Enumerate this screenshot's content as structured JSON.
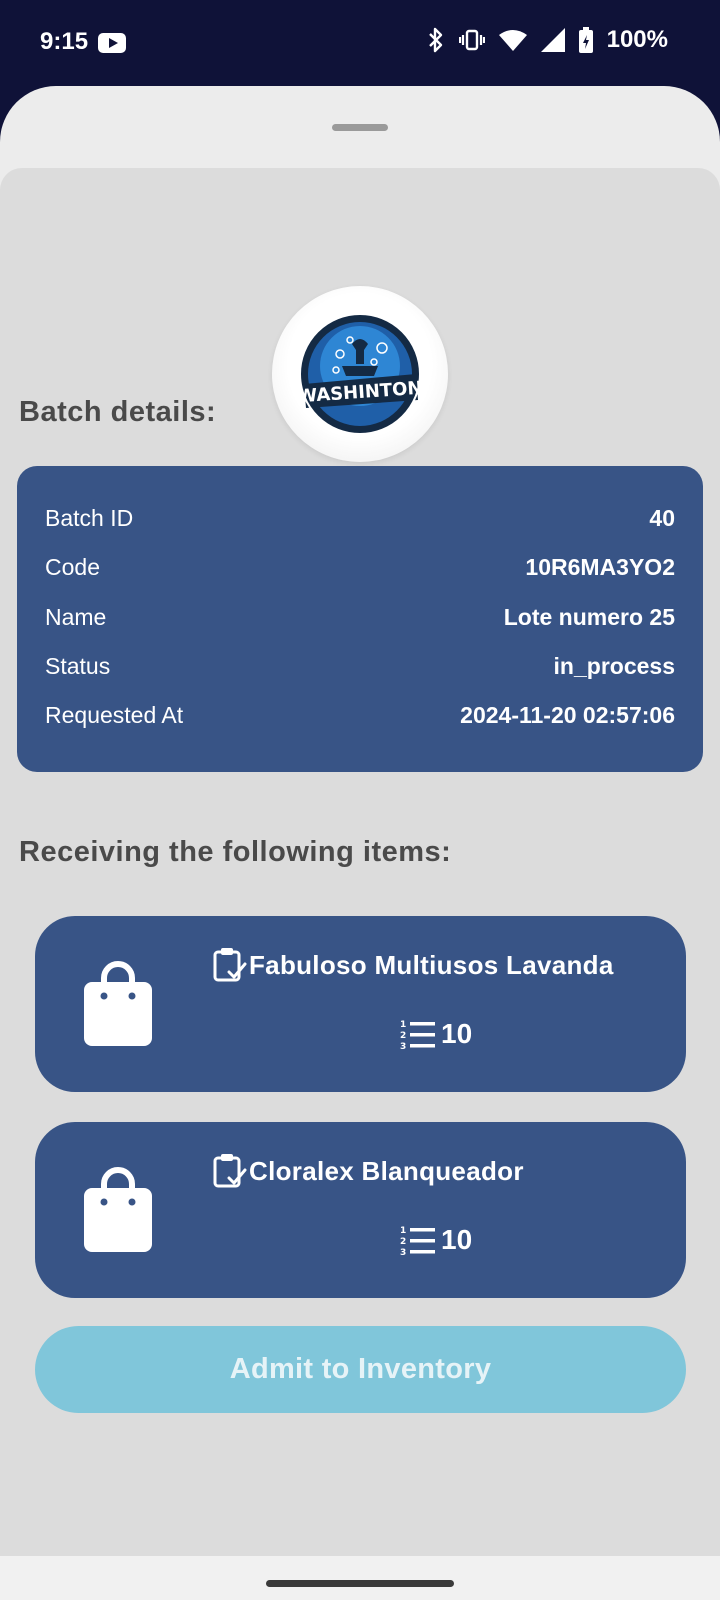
{
  "status_bar": {
    "time": "9:15",
    "battery_text": "100%",
    "icons": [
      "youtube-icon",
      "bluetooth-icon",
      "vibrate-icon",
      "wifi-icon",
      "signal-icon",
      "battery-charging-icon"
    ]
  },
  "logo": {
    "text": "WASHINTON"
  },
  "batch_section": {
    "title": "Batch details:",
    "rows": [
      {
        "label": "Batch ID",
        "value": "40"
      },
      {
        "label": "Code",
        "value": "10R6MA3YO2"
      },
      {
        "label": "Name",
        "value": "Lote numero 25"
      },
      {
        "label": "Status",
        "value": "in_process"
      },
      {
        "label": "Requested At",
        "value": "2024-11-20 02:57:06"
      }
    ]
  },
  "items_section": {
    "title": "Receiving the following items:",
    "items": [
      {
        "name": "Fabuloso Multiusos Lavanda",
        "quantity": "10"
      },
      {
        "name": "Cloralex Blanqueador",
        "quantity": "10"
      }
    ]
  },
  "admit_button": {
    "label": "Admit to Inventory"
  },
  "colors": {
    "card": "#385486",
    "button": "#80c6da",
    "status_bar": "#0f1238",
    "sheet": "#ececec",
    "panel": "#dcdcdc"
  }
}
